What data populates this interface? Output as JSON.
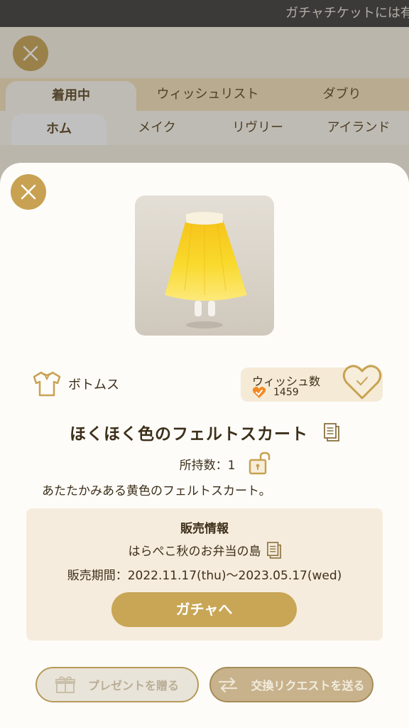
{
  "marquee": {
    "text": "ガチャチケットには有"
  },
  "background_tabs": {
    "primary": [
      "着用中",
      "ウィッシュリスト",
      "ダブり"
    ],
    "secondary": [
      "ホム",
      "メイク",
      "リヴリー",
      "アイランド"
    ]
  },
  "item": {
    "category": "ボトムス",
    "name": "ほくほく色のフェルトスカート",
    "owned": "所持数：1",
    "description": "あたたかみある黄色のフェルトスカート。"
  },
  "wish": {
    "label": "ウィッシュ数",
    "count": "1459"
  },
  "sale": {
    "title": "販売情報",
    "island": "はらぺこ秋のお弁当の島",
    "period": "販売期間：2022.11.17(thu)〜2023.05.17(wed)",
    "gacha_button": "ガチャへ"
  },
  "actions": {
    "present": "プレゼントを贈る",
    "trade": "交換リクエストを送る"
  },
  "icons": [
    "close-icon",
    "shirt-icon",
    "heart-icon",
    "document-icon",
    "unlock-icon",
    "gift-icon",
    "trade-icon"
  ],
  "colors": {
    "accent": "#c8a252",
    "panel": "#f6ecdd",
    "text": "#3d2f19"
  }
}
